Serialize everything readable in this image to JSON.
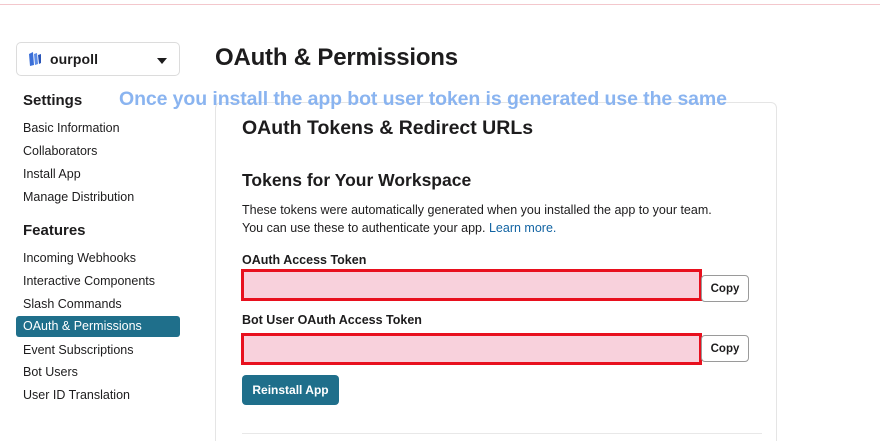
{
  "app": {
    "name": "ourpoll"
  },
  "page": {
    "title": "OAuth & Permissions"
  },
  "annotation": "Once you install the app bot user token is generated use the same",
  "sidebar": {
    "settings_heading": "Settings",
    "settings_items": [
      "Basic Information",
      "Collaborators",
      "Install App",
      "Manage Distribution"
    ],
    "features_heading": "Features",
    "features_items": [
      "Incoming Webhooks",
      "Interactive Components",
      "Slash Commands",
      "OAuth & Permissions",
      "Event Subscriptions",
      "Bot Users",
      "User ID Translation"
    ],
    "active_item": "OAuth & Permissions"
  },
  "card": {
    "title": "OAuth Tokens & Redirect URLs",
    "section_title": "Tokens for Your Workspace",
    "desc_line1": "These tokens were automatically generated when you installed the app to your team.",
    "desc_line2": "You can use these to authenticate your app.",
    "learn_more": "Learn more.",
    "oauth_label": "OAuth Access Token",
    "oauth_value": "",
    "bot_label": "Bot User OAuth Access Token",
    "bot_value": "",
    "copy_label": "Copy",
    "reinstall_label": "Reinstall App"
  },
  "colors": {
    "accent": "#1f6f8b",
    "highlight_border": "#e8101e",
    "highlight_fill": "#f8d1dc",
    "annotation": "#8ab4f0"
  },
  "icons": {
    "app_icon": "app-logo-icon",
    "dropdown": "chevron-down-icon"
  }
}
